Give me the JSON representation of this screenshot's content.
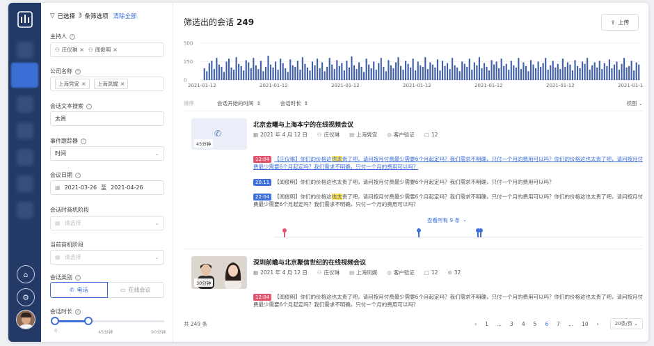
{
  "filter": {
    "header_count_prefix": "已选择",
    "header_count": "3",
    "header_count_suffix": "条筛选项",
    "clear_all": "清除全部",
    "host_label": "主持人",
    "host_tags": [
      "庄仪琳",
      "闻俊明"
    ],
    "company_label": "公司名称",
    "company_tags": [
      "上海凭安",
      "上海凤娓"
    ],
    "text_search_label": "会话文本搜索",
    "text_search_value": "太贵",
    "event_tracker_label": "事件跟踪器",
    "event_tracker_value": "时间",
    "date_label": "会议日期",
    "date_start": "2021-03-26",
    "date_sep": "至",
    "date_end": "2021-04-26",
    "stage_label": "会话时商机阶段",
    "stage_placeholder": "请选择",
    "current_stage_label": "当前商机阶段",
    "current_stage_placeholder": "请选择",
    "type_label": "会话类别",
    "type_phone": "电话",
    "type_online": "在线会议",
    "duration_label": "会话时长",
    "duration_ticks": [
      "0",
      "45分钟",
      "90分钟"
    ],
    "duration_value_fraction": 0.5
  },
  "main": {
    "title": "筛选出的会话",
    "count": "249",
    "upload_label": "上传",
    "sort_prefix": "排序",
    "sort_start": "会话开始的时间",
    "sort_duration": "会话时长",
    "view_label": "视图",
    "see_all": "查看所有 9 条",
    "total": "共 249 条",
    "pages": [
      "1",
      "...",
      "3",
      "4",
      "5",
      "6",
      "7",
      "...",
      "10"
    ],
    "current_page": "6",
    "per_page": "20条/页"
  },
  "chart_data": {
    "type": "bar",
    "yticks": [
      "500",
      "250",
      "0"
    ],
    "ylim": [
      0,
      500
    ],
    "x_tick_labels": [
      "2021-01-12",
      "2021-01-12",
      "2021-01-12",
      "2021-01-12",
      "2021-01-12",
      "2021-01-12",
      "2021-01-12"
    ],
    "values": [
      160,
      120,
      230,
      260,
      150,
      300,
      210,
      180,
      110,
      250,
      290,
      170,
      140,
      310,
      220,
      190,
      130,
      270,
      240,
      160,
      300,
      200,
      150,
      260,
      120,
      180,
      330,
      210,
      170,
      250,
      140,
      290,
      230,
      160,
      110,
      280,
      200,
      180,
      260,
      140,
      310,
      220,
      170,
      130,
      250,
      200,
      290,
      160,
      240,
      120,
      180,
      300,
      210,
      150,
      270,
      190,
      230,
      130,
      260,
      170,
      320,
      200,
      150,
      240,
      180,
      110,
      290,
      210,
      160,
      250,
      140,
      230,
      300,
      180,
      120,
      270,
      200,
      160,
      240,
      310,
      190,
      140,
      260,
      220,
      170,
      290,
      130,
      250,
      200,
      180,
      310,
      150,
      240,
      210,
      170,
      280,
      130,
      260,
      190,
      230,
      150,
      300,
      200,
      170,
      120,
      250,
      220,
      180,
      290,
      140,
      240,
      200,
      310,
      160,
      230,
      180,
      130,
      270,
      210,
      250,
      160,
      290,
      190,
      220,
      140,
      260,
      200,
      170,
      300,
      150,
      240,
      190,
      120,
      270,
      210,
      160,
      250,
      180,
      230,
      300,
      140,
      200,
      260,
      170,
      220,
      150,
      290,
      180,
      240,
      210,
      130,
      270,
      190,
      160,
      250,
      220,
      300,
      140,
      200,
      240,
      170,
      260,
      150,
      230,
      190,
      280,
      160,
      210,
      250,
      140,
      220,
      300,
      170,
      190,
      260,
      130,
      240,
      210
    ]
  },
  "calls": [
    {
      "title": "北京金曦与上海本宁的在线视频会议",
      "date": "2021 年 4 月 12 日",
      "host": "庄仪琳",
      "company": "上海凭安",
      "tag": "客户验证",
      "comments": "12",
      "duration": "45分钟",
      "quotes": [
        {
          "time": "12:04",
          "color": "red",
          "pre": "【庄仪琳】你们的价格这",
          "hl": "也太",
          "post": "贵了吧，请问按月付费最少需要6个月起定吗？我们需求不明确，只付一个月的费用可以吗？你们的价格这也太贵了吧，请问按月付费最少需要6个月起定吗？我们需求不明确，只付一个月的费用可以吗？"
        },
        {
          "time": "20:11",
          "color": "blue",
          "pre": "【闻俊明】你们的价格这也太贵了吧，请问按月付费最少需要6个月起定吗？我们需求不明确，只付一个月的费用可以吗？",
          "hl": "",
          "post": ""
        },
        {
          "time": "22:04",
          "color": "blue",
          "pre": "【闻俊明】你们的价格这",
          "hl": "也太",
          "post": "贵了吧，请问按月付费最少需要6个月起定吗？我们需求不明确，只付一个月的费用可以吗？你们的价格这也太贵了吧，请问按月付费最少需要6个月起定吗？我们需求不明确，只付一个月的费用可以吗？"
        }
      ]
    },
    {
      "title": "深圳前瞻与北京聚信世纪的在线视频会议",
      "date": "2021 年 4 月 12 日",
      "host": "庄仪琳",
      "company": "上海凤娓",
      "tag": "客户验证",
      "comments": "12",
      "shares": "32",
      "duration": "30分钟",
      "quotes": [
        {
          "time": "12:04",
          "color": "red",
          "pre": "【闻俊明】你们的价格这也太贵了吧，请问按月付费最少需要6个月起定吗？我们需求不明确，只付一个月的费用可以吗？你们的价格这也太贵了吧，请问按月付费最少需要6个月起定吗？我们需求不明确，只付一个月的费用可以吗？",
          "hl": "",
          "post": ""
        }
      ]
    }
  ]
}
